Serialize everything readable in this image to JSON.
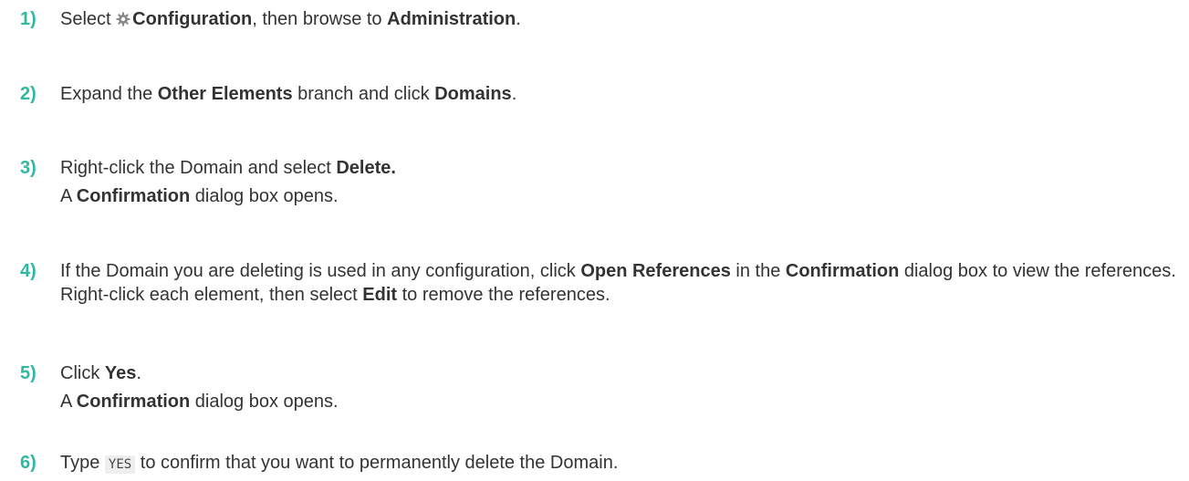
{
  "steps": [
    {
      "number": "1)",
      "segments": [
        "Select ",
        "Configuration",
        ", then browse to ",
        "Administration",
        "."
      ]
    },
    {
      "number": "2)",
      "segments": [
        "Expand the ",
        "Other Elements",
        " branch and click ",
        "Domains",
        "."
      ]
    },
    {
      "number": "3)",
      "segments": [
        "Right-click the Domain and select ",
        "Delete."
      ],
      "result": [
        "A ",
        "Confirmation",
        " dialog box opens."
      ]
    },
    {
      "number": "4)",
      "segments": [
        "If the Domain you are deleting is used in any configuration, click ",
        "Open References",
        " in the ",
        "Confirmation",
        " dialog box to view the references. Right-click each element, then select ",
        "Edit",
        " to remove the references."
      ]
    },
    {
      "number": "5)",
      "segments": [
        "Click ",
        "Yes",
        "."
      ],
      "result": [
        "A ",
        "Confirmation",
        " dialog box opens."
      ]
    },
    {
      "number": "6)",
      "segments": [
        "Type ",
        "YES",
        " to confirm that you want to permanently delete the Domain."
      ]
    }
  ],
  "icons": {
    "configuration": "gear-icon"
  },
  "colors": {
    "step_number": "#2fb8a2",
    "text": "#333333",
    "code_background": "#eeeeee"
  }
}
